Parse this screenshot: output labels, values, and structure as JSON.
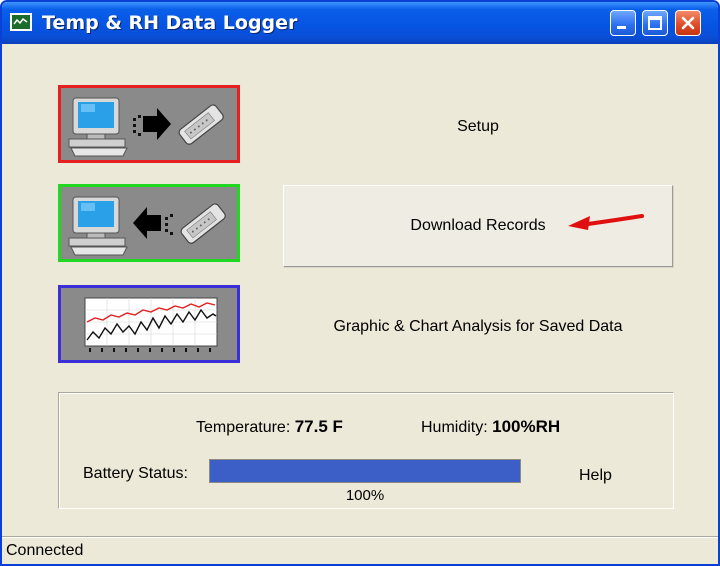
{
  "window": {
    "title": "Temp & RH Data Logger",
    "accent_color": "#0a5fe8"
  },
  "icons": {
    "app": "chart-icon",
    "setup": "computer-to-logger-icon",
    "download": "logger-to-computer-icon",
    "chart": "line-chart-icon"
  },
  "actions": {
    "setup_label": "Setup",
    "download_label": "Download Records",
    "chart_label": "Graphic & Chart Analysis for Saved Data"
  },
  "readings": {
    "temperature_label": "Temperature:",
    "temperature_value": "77.5 F",
    "humidity_label": "Humidity:",
    "humidity_value": "100%RH"
  },
  "battery": {
    "label": "Battery Status:",
    "level_percent": 100,
    "level_text": "100%",
    "fill_color": "#3b5fc6"
  },
  "help_label": "Help",
  "status_bar": {
    "text": "Connected"
  }
}
